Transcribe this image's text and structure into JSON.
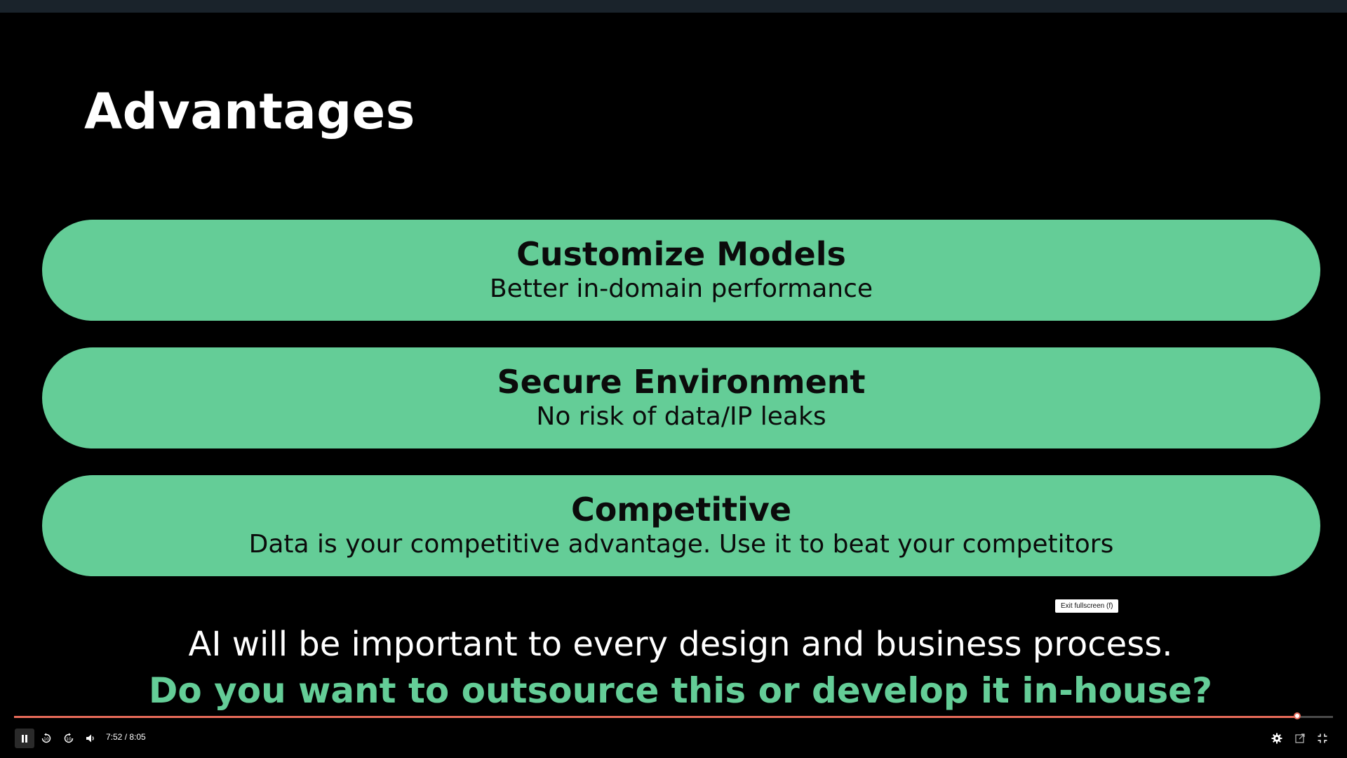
{
  "slide": {
    "title": "Advantages",
    "cards": [
      {
        "title": "Customize Models",
        "subtitle": "Better in-domain performance"
      },
      {
        "title": "Secure Environment",
        "subtitle": "No risk of data/IP leaks"
      },
      {
        "title": "Competitive",
        "subtitle": "Data is your competitive advantage. Use it to beat your competitors"
      }
    ],
    "statement": "AI will be important to every design and business process.",
    "question": "Do you want to outsource this or develop it in-house?"
  },
  "tooltip": {
    "text": "Exit fullscreen (f)"
  },
  "player": {
    "current_time": "7:52",
    "duration": "8:05",
    "progress_fraction": 0.973,
    "time_display": "7:52 / 8:05",
    "accent_color": "#e86b5a",
    "buttons": {
      "play_pause": "pause-icon",
      "rewind": "rewind-10-icon",
      "forward": "forward-10-icon",
      "volume": "volume-icon",
      "settings": "gear-icon",
      "popout": "popout-icon",
      "fullscreen": "exit-fullscreen-icon"
    }
  },
  "colors": {
    "card_green": "#64cd97",
    "question_green": "#64cd97",
    "background": "#000000"
  }
}
